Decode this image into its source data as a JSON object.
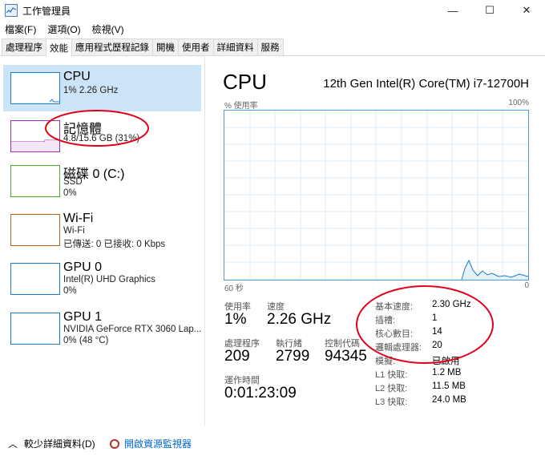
{
  "window": {
    "title": "工作管理員",
    "icon": "task-manager-icon",
    "controls": {
      "minimize": "—",
      "maximize": "☐",
      "close": "✕"
    }
  },
  "menu": [
    "檔案(F)",
    "選項(O)",
    "檢視(V)"
  ],
  "tabs": [
    {
      "label": "處理程序",
      "active": false
    },
    {
      "label": "效能",
      "active": true
    },
    {
      "label": "應用程式歷程記錄",
      "active": false
    },
    {
      "label": "開機",
      "active": false
    },
    {
      "label": "使用者",
      "active": false
    },
    {
      "label": "詳細資料",
      "active": false
    },
    {
      "label": "服務",
      "active": false
    }
  ],
  "perf_items": [
    {
      "name": "CPU",
      "lines": [
        "1% 2.26 GHz"
      ],
      "color": "#1a7bc9",
      "selected": true
    },
    {
      "name": "記憶體",
      "lines": [
        "4.8/15.6 GB (31%)"
      ],
      "color": "#9b31b5",
      "selected": false
    },
    {
      "name": "磁碟 0 (C:)",
      "lines": [
        "SSD",
        "0%"
      ],
      "color": "#4da629",
      "selected": false
    },
    {
      "name": "Wi-Fi",
      "lines": [
        "Wi-Fi",
        "已傳送: 0 已接收: 0 Kbps"
      ],
      "color": "#b5651d",
      "selected": false
    },
    {
      "name": "GPU 0",
      "lines": [
        "Intel(R) UHD Graphics",
        "0%"
      ],
      "color": "#1a7bc9",
      "selected": false
    },
    {
      "name": "GPU 1",
      "lines": [
        "NVIDIA GeForce RTX 3060 Lap...",
        "0% (48 °C)"
      ],
      "color": "#1a7bc9",
      "selected": false
    }
  ],
  "detail": {
    "title": "CPU",
    "model": "12th Gen Intel(R) Core(TM) i7-12700H",
    "graph_label": "% 使用率",
    "graph_max": "100%",
    "graph_time": "60 秒",
    "graph_min": "0",
    "usage_label": "使用率",
    "usage_value": "1%",
    "speed_label": "速度",
    "speed_value": "2.26 GHz",
    "processes_label": "處理程序",
    "processes_value": "209",
    "threads_label": "執行緒",
    "threads_value": "2799",
    "handles_label": "控制代碼",
    "handles_value": "94345",
    "uptime_label": "運作時間",
    "uptime_value": "0:01:23:09",
    "specs": [
      {
        "label": "基本速度:",
        "value": "2.30 GHz"
      },
      {
        "label": "插槽:",
        "value": "1"
      },
      {
        "label": "核心數目:",
        "value": "14"
      },
      {
        "label": "邏輯處理器:",
        "value": "20"
      },
      {
        "label": "模擬:",
        "value": "已啟用"
      },
      {
        "label": "L1 快取:",
        "value": "1.2 MB"
      },
      {
        "label": "L2 快取:",
        "value": "11.5 MB"
      },
      {
        "label": "L3 快取:",
        "value": "24.0 MB"
      }
    ]
  },
  "bottom": {
    "fewer_details": "較少詳細資料(D)",
    "open_monitor": "開啟資源監視器"
  },
  "colors": {
    "selected_bg": "#cce4f7",
    "graph_border": "#4a9bd6",
    "grid": "#dcebf7",
    "annotation": "#e0001a"
  }
}
